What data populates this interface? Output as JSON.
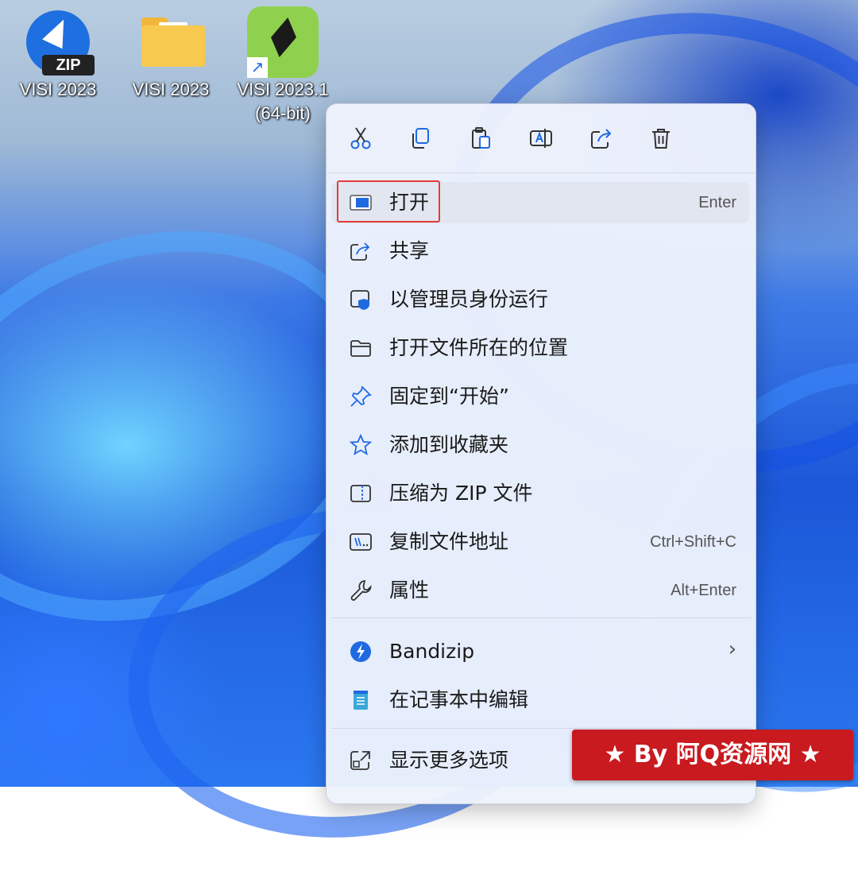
{
  "desktop": {
    "icons": [
      {
        "label": "VISI 2023",
        "icon": "bandizip-zip-icon"
      },
      {
        "label": "VISI 2023",
        "icon": "folder-icon"
      },
      {
        "label": "VISI 2023.1\n(64-bit)",
        "icon": "visi-app-shortcut-icon"
      }
    ]
  },
  "context_menu": {
    "toolbar": [
      "cut-icon",
      "copy-icon",
      "paste-icon",
      "rename-icon",
      "share-icon",
      "delete-icon"
    ],
    "items": [
      {
        "label": "打开",
        "shortcut": "Enter",
        "icon": "window-icon",
        "highlighted": true
      },
      {
        "label": "共享",
        "shortcut": "",
        "icon": "share-icon"
      },
      {
        "label": "以管理员身份运行",
        "shortcut": "",
        "icon": "admin-shield-icon"
      },
      {
        "label": "打开文件所在的位置",
        "shortcut": "",
        "icon": "folder-open-icon"
      },
      {
        "label": "固定到“开始”",
        "shortcut": "",
        "icon": "pin-icon"
      },
      {
        "label": "添加到收藏夹",
        "shortcut": "",
        "icon": "star-icon"
      },
      {
        "label": "压缩为 ZIP 文件",
        "shortcut": "",
        "icon": "zip-folder-icon"
      },
      {
        "label": "复制文件地址",
        "shortcut": "Ctrl+Shift+C",
        "icon": "copy-path-icon"
      },
      {
        "label": "属性",
        "shortcut": "Alt+Enter",
        "icon": "wrench-icon"
      },
      {
        "label": "Bandizip",
        "shortcut": "",
        "icon": "bandizip-icon",
        "submenu": true
      },
      {
        "label": "在记事本中编辑",
        "shortcut": "",
        "icon": "notepad-icon"
      },
      {
        "label": "显示更多选项",
        "shortcut": "",
        "icon": "more-options-icon"
      }
    ]
  },
  "colors": {
    "highlight_box": "#e23b3b",
    "accent": "#1f6ae0",
    "watermark_bg": "#c81a1f"
  },
  "watermark": {
    "text": "★ By 阿Q资源网 ★"
  }
}
